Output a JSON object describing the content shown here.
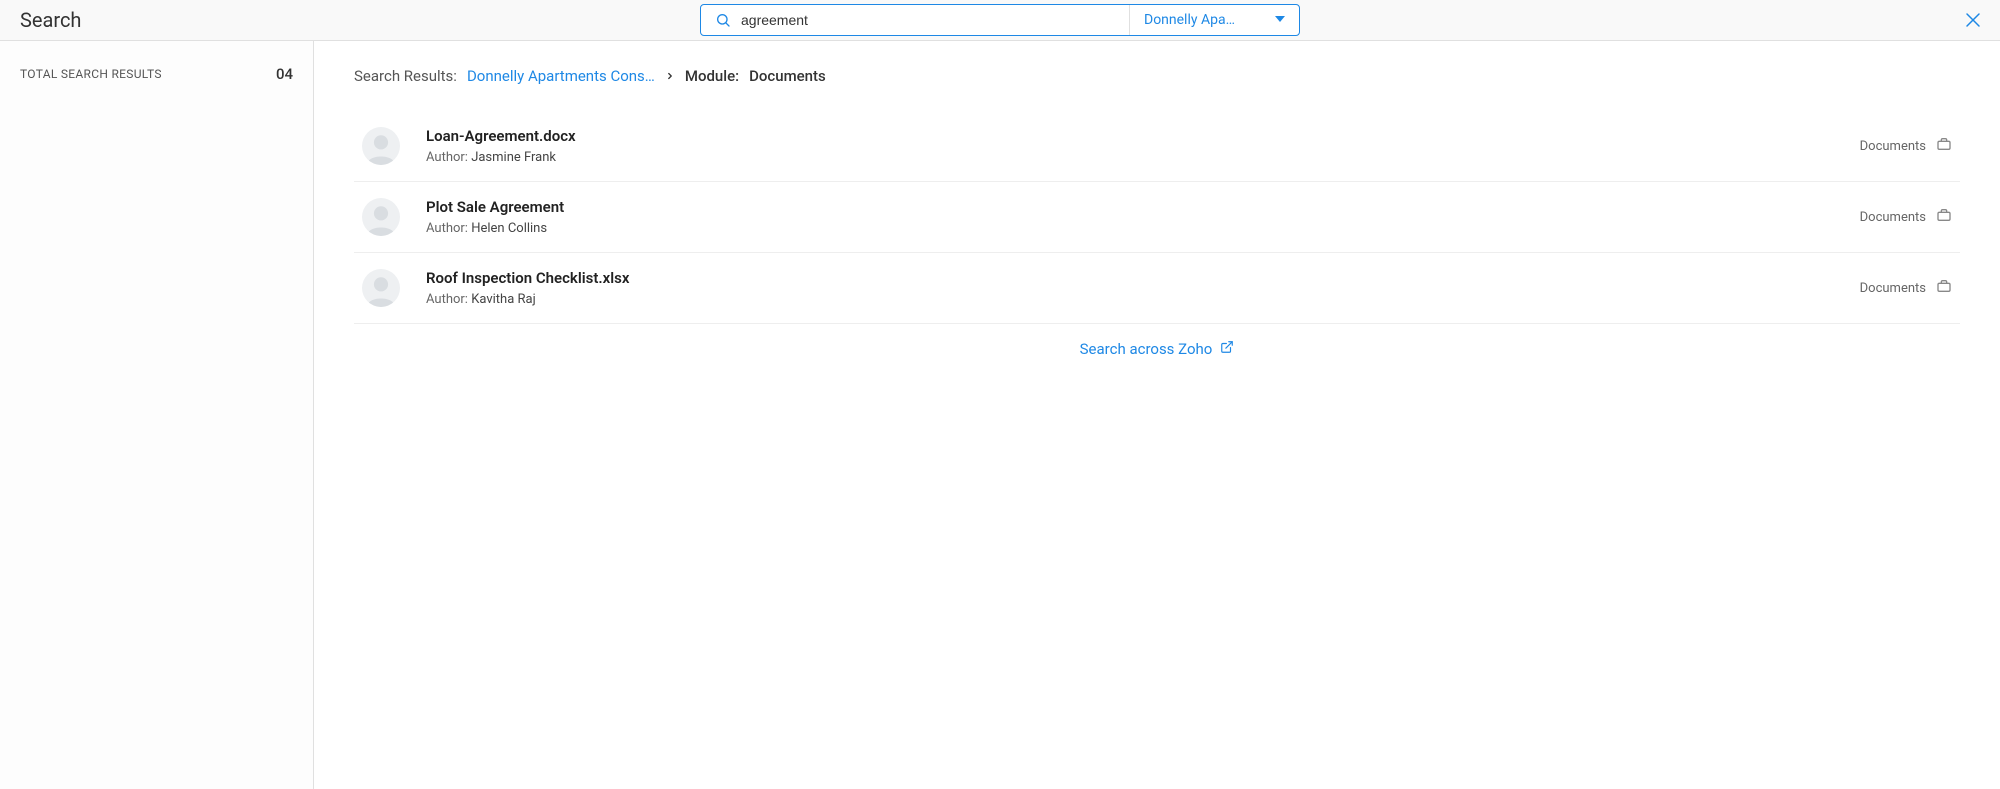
{
  "header": {
    "title": "Search",
    "search_value": "agreement",
    "filter_label": "Donnelly Apa…"
  },
  "sidebar": {
    "total_label": "TOTAL SEARCH RESULTS",
    "total_count": "04"
  },
  "breadcrumb": {
    "results_label": "Search Results:",
    "project_link": "Donnelly Apartments Cons…",
    "module_label": "Module:",
    "module_value": "Documents"
  },
  "results": [
    {
      "title": "Loan-Agreement.docx",
      "author_label": "Author: ",
      "author_name": "Jasmine Frank",
      "type": "Documents"
    },
    {
      "title": "Plot Sale Agreement",
      "author_label": "Author: ",
      "author_name": "Helen Collins",
      "type": "Documents"
    },
    {
      "title": "Roof Inspection Checklist.xlsx",
      "author_label": "Author: ",
      "author_name": "Kavitha Raj",
      "type": "Documents"
    }
  ],
  "footer": {
    "search_across_label": "Search across Zoho"
  }
}
